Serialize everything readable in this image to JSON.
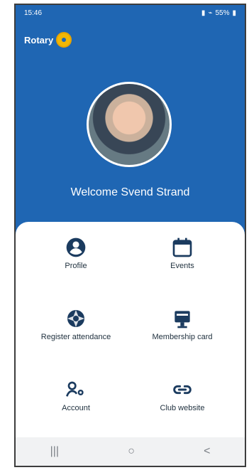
{
  "status_bar": {
    "time": "15:46",
    "battery": "55%"
  },
  "header": {
    "brand": "Rotary"
  },
  "profile": {
    "welcome_text": "Welcome Svend Strand"
  },
  "menu": [
    {
      "label": "Profile",
      "icon": "user-circle-icon"
    },
    {
      "label": "Events",
      "icon": "calendar-icon"
    },
    {
      "label": "Register attendance",
      "icon": "camera-shutter-icon"
    },
    {
      "label": "Membership card",
      "icon": "id-card-icon"
    },
    {
      "label": "Account",
      "icon": "user-gear-icon"
    },
    {
      "label": "Club website",
      "icon": "link-icon"
    }
  ],
  "nav": {
    "recents": "|||",
    "home": "○",
    "back": "<"
  },
  "colors": {
    "primary": "#1f66b3",
    "accent": "#f2b705",
    "icon": "#1b3b5f"
  }
}
